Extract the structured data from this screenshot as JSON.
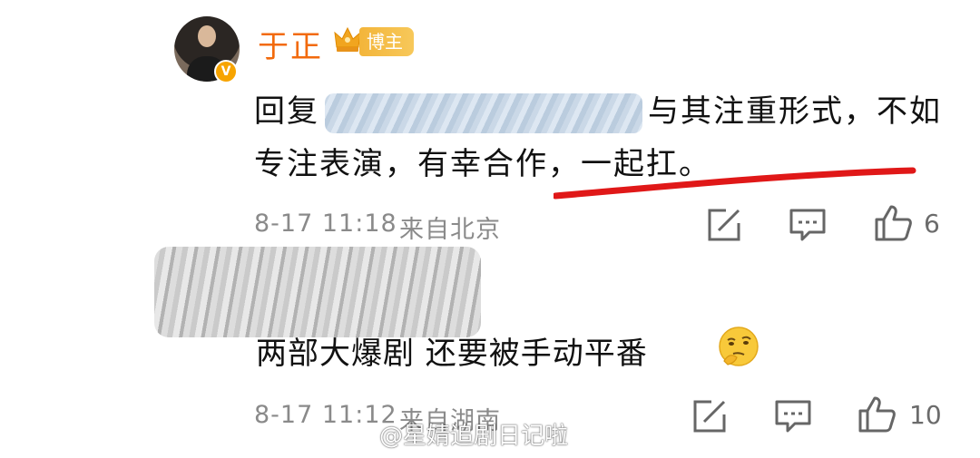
{
  "colors": {
    "username": "#f26a0c",
    "badge": "#f3b53a",
    "verified": "#f7a400",
    "underline": "#e01818",
    "meta": "#8a8a8a"
  },
  "comment1": {
    "username": "于正",
    "badge": "博主",
    "verified_mark": "V",
    "reply_prefix": "回复",
    "text_after_blur": "与其注重形式，不如专注表演，有幸合作，一起扛。",
    "time": "8-17 11:18",
    "location": "来自北京",
    "like_count": "6",
    "icons": [
      "share-icon",
      "comment-icon",
      "like-icon"
    ]
  },
  "comment2": {
    "text": "两部大爆剧 还要被手动平番",
    "emoji": "thinking-face-emoji",
    "time": "8-17 11:12",
    "location": "来自湖南",
    "like_count": "10",
    "icons": [
      "share-icon",
      "comment-icon",
      "like-icon"
    ]
  },
  "watermark": "@星婧追剧日记啦"
}
